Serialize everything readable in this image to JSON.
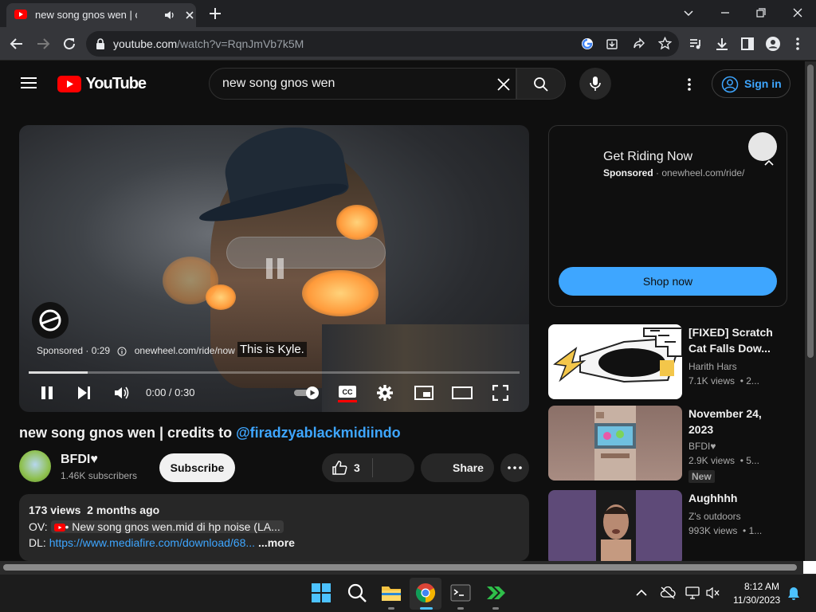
{
  "browser": {
    "tab_title": "new song gnos wen | credits",
    "url_host": "youtube.com",
    "url_path": "/watch?v=RqnJmVb7k5M"
  },
  "header": {
    "logo_text": "YouTube",
    "search_query": "new song gnos wen",
    "signin_label": "Sign in"
  },
  "player": {
    "sponsor_text": "Sponsored · 0:29",
    "sponsor_url": "onewheel.com/ride/now",
    "caption": "This is Kyle.",
    "time": "0:00 / 0:30",
    "progress_fraction": 0.12
  },
  "video": {
    "title_text": "new song gnos wen | credits to ",
    "title_link": "@firadzyablackmidiindo",
    "channel_name": "BFDI♥",
    "channel_subs": "1.46K subscribers",
    "subscribe_label": "Subscribe",
    "like_count": "3",
    "share_label": "Share",
    "description": {
      "stats": "173 views  2 months ago",
      "line2_prefix": "OV: ",
      "line2_chip": "• New song gnos wen.mid di hp noise (LA...",
      "line3_prefix": "DL: ",
      "line3_link": "https://www.mediafire.com/download/68...",
      "more": "...more"
    }
  },
  "ad": {
    "title": "Get Riding Now",
    "sponsored": "Sponsored",
    "url": " · onewheel.com/ride/",
    "cta": "Shop now"
  },
  "recommendations": [
    {
      "title": "[FIXED] Scratch Cat Falls Dow...",
      "channel": "Harith Hars",
      "meta": "7.1K views  • 2..."
    },
    {
      "title": "November 24, 2023",
      "channel": "BFDI♥",
      "meta": "2.9K views  • 5...",
      "badge": "New"
    },
    {
      "title": "Aughhhh",
      "channel": "Z's outdoors",
      "meta": "993K views  • 1..."
    }
  ],
  "taskbar": {
    "time": "8:12 AM",
    "date": "11/30/2023"
  },
  "colors": {
    "youtube_red": "#ff0000",
    "link_blue": "#3ea6ff",
    "page_bg": "#0f0f0f"
  }
}
